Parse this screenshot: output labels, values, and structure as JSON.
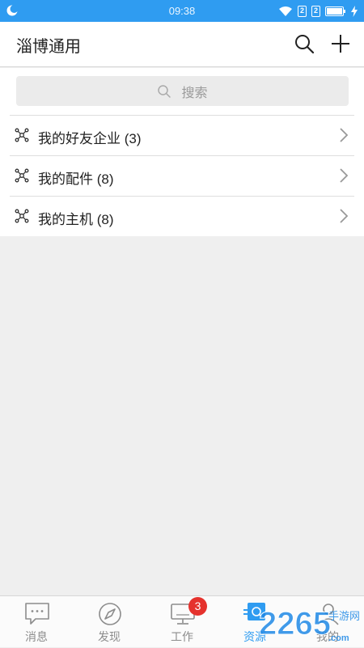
{
  "status_bar": {
    "time": "09:38",
    "sim1": "2",
    "sim2": "2"
  },
  "header": {
    "title": "淄博通用",
    "icons": [
      "search-icon",
      "plus-icon"
    ]
  },
  "search": {
    "placeholder": "搜索"
  },
  "list": {
    "items": [
      {
        "label": "我的好友企业 (3)",
        "icon": "node-icon"
      },
      {
        "label": "我的配件 (8)",
        "icon": "node-icon"
      },
      {
        "label": "我的主机 (8)",
        "icon": "node-icon"
      }
    ]
  },
  "bottom_nav": {
    "tabs": [
      {
        "label": "消息",
        "icon": "message-icon"
      },
      {
        "label": "发现",
        "icon": "compass-icon"
      },
      {
        "label": "工作",
        "icon": "monitor-icon",
        "badge": "3"
      },
      {
        "label": "资源",
        "icon": "resource-icon",
        "active": true
      },
      {
        "label": "我的",
        "icon": "user-icon"
      }
    ]
  },
  "colors": {
    "primary": "#2f9cf1",
    "badge": "#e5322d",
    "background": "#efefef"
  },
  "watermark": {
    "brand": "2265",
    "suffix": ".com",
    "tagline": "手游网"
  }
}
